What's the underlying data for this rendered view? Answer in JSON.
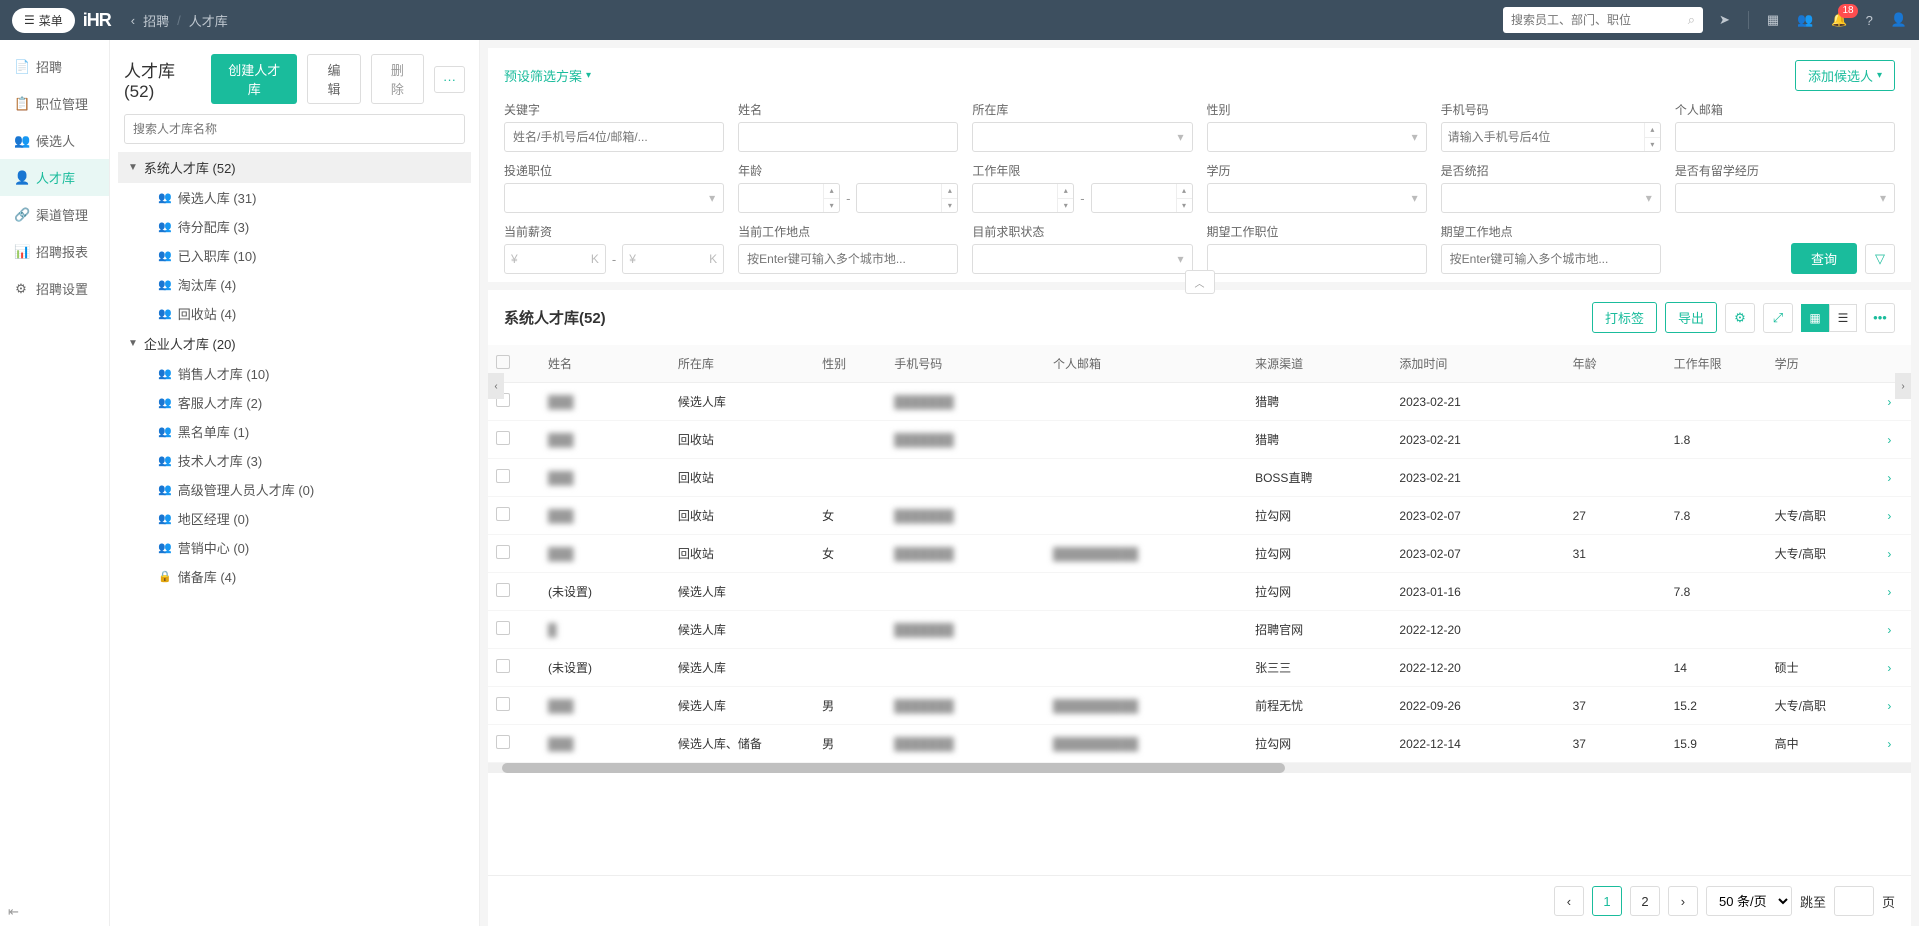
{
  "header": {
    "menu_label": "菜单",
    "logo": "iHR",
    "breadcrumb_back": "‹",
    "breadcrumb_a": "招聘",
    "breadcrumb_sep": "/",
    "breadcrumb_b": "人才库",
    "search_placeholder": "搜索员工、部门、职位",
    "badge_count": "18"
  },
  "nav": {
    "items": [
      {
        "label": "招聘",
        "icon": "📄"
      },
      {
        "label": "职位管理",
        "icon": "📋"
      },
      {
        "label": "候选人",
        "icon": "👥"
      },
      {
        "label": "人才库",
        "icon": "👤",
        "active": true
      },
      {
        "label": "渠道管理",
        "icon": "🔗"
      },
      {
        "label": "招聘报表",
        "icon": "📊"
      },
      {
        "label": "招聘设置",
        "icon": "⚙"
      }
    ]
  },
  "sidebar": {
    "title": "人才库  (52)",
    "btn_create": "创建人才库",
    "btn_edit": "编辑",
    "btn_delete": "删除",
    "btn_more": "···",
    "search_placeholder": "搜索人才库名称",
    "group1": {
      "title": "系统人才库  (52)",
      "items": [
        {
          "label": "候选人库  (31)"
        },
        {
          "label": "待分配库  (3)"
        },
        {
          "label": "已入职库  (10)"
        },
        {
          "label": "淘汰库  (4)"
        },
        {
          "label": "回收站  (4)"
        }
      ]
    },
    "group2": {
      "title": "企业人才库  (20)",
      "items": [
        {
          "label": "销售人才库  (10)"
        },
        {
          "label": "客服人才库  (2)"
        },
        {
          "label": "黑名单库  (1)"
        },
        {
          "label": "技术人才库  (3)"
        },
        {
          "label": "高级管理人员人才库  (0)"
        },
        {
          "label": "地区经理  (0)"
        },
        {
          "label": "营销中心  (0)"
        },
        {
          "label": "储备库  (4)",
          "locked": true
        }
      ]
    }
  },
  "filters": {
    "preset_label": "预设筛选方案",
    "add_candidate": "添加候选人",
    "labels": {
      "keyword": "关键字",
      "name": "姓名",
      "pool": "所在库",
      "gender": "性别",
      "phone": "手机号码",
      "email": "个人邮箱",
      "position": "投递职位",
      "age": "年龄",
      "workyear": "工作年限",
      "education": "学历",
      "unified": "是否统招",
      "abroad": "是否有留学经历",
      "salary": "当前薪资",
      "location": "当前工作地点",
      "jobstatus": "目前求职状态",
      "expect_pos": "期望工作职位",
      "expect_loc": "期望工作地点"
    },
    "placeholders": {
      "keyword": "姓名/手机号后4位/邮箱/...",
      "phone": "请输入手机号后4位",
      "location": "按Enter键可输入多个城市地...",
      "expect_loc": "按Enter键可输入多个城市地...",
      "salary_prefix": "¥",
      "salary_suffix": "K"
    },
    "btn_query": "查询"
  },
  "table": {
    "title": "系统人才库(52)",
    "btn_tag": "打标签",
    "btn_export": "导出",
    "columns": {
      "name": "姓名",
      "pool": "所在库",
      "gender": "性别",
      "phone": "手机号码",
      "email": "个人邮箱",
      "channel": "来源渠道",
      "addtime": "添加时间",
      "age": "年龄",
      "workyear": "工作年限",
      "education": "学历"
    },
    "rows": [
      {
        "name": "███",
        "pool": "候选人库",
        "gender": "",
        "phone": "███████",
        "email": "",
        "channel": "猎聘",
        "addtime": "2023-02-21",
        "age": "",
        "workyear": "",
        "education": ""
      },
      {
        "name": "███",
        "pool": "回收站",
        "gender": "",
        "phone": "███████",
        "email": "",
        "channel": "猎聘",
        "addtime": "2023-02-21",
        "age": "",
        "workyear": "1.8",
        "education": ""
      },
      {
        "name": "███",
        "pool": "回收站",
        "gender": "",
        "phone": "",
        "email": "",
        "channel": "BOSS直聘",
        "addtime": "2023-02-21",
        "age": "",
        "workyear": "",
        "education": ""
      },
      {
        "name": "███",
        "pool": "回收站",
        "gender": "女",
        "phone": "███████",
        "email": "",
        "channel": "拉勾网",
        "addtime": "2023-02-07",
        "age": "27",
        "workyear": "7.8",
        "education": "大专/高职"
      },
      {
        "name": "███",
        "pool": "回收站",
        "gender": "女",
        "phone": "███████",
        "email": "██████████",
        "channel": "拉勾网",
        "addtime": "2023-02-07",
        "age": "31",
        "workyear": "",
        "education": "大专/高职"
      },
      {
        "name": "(未设置)",
        "plain": true,
        "pool": "候选人库",
        "gender": "",
        "phone": "",
        "email": "",
        "channel": "拉勾网",
        "addtime": "2023-01-16",
        "age": "",
        "workyear": "7.8",
        "education": ""
      },
      {
        "name": "█",
        "pool": "候选人库",
        "gender": "",
        "phone": "███████",
        "email": "",
        "channel": "招聘官网",
        "addtime": "2022-12-20",
        "age": "",
        "workyear": "",
        "education": ""
      },
      {
        "name": "(未设置)",
        "plain": true,
        "pool": "候选人库",
        "gender": "",
        "phone": "",
        "email": "",
        "channel": "张三三",
        "addtime": "2022-12-20",
        "age": "",
        "workyear": "14",
        "education": "硕士"
      },
      {
        "name": "███",
        "pool": "候选人库",
        "gender": "男",
        "phone": "███████",
        "email": "██████████",
        "channel": "前程无忧",
        "addtime": "2022-09-26",
        "age": "37",
        "workyear": "15.2",
        "education": "大专/高职"
      },
      {
        "name": "███",
        "pool": "候选人库、储备",
        "gender": "男",
        "phone": "███████",
        "email": "██████████",
        "channel": "拉勾网",
        "addtime": "2022-12-14",
        "age": "37",
        "workyear": "15.9",
        "education": "高中"
      }
    ]
  },
  "pagination": {
    "pages": [
      "1",
      "2"
    ],
    "current": "1",
    "size_label": "50 条/页",
    "jump_label": "跳至",
    "jump_unit": "页"
  }
}
